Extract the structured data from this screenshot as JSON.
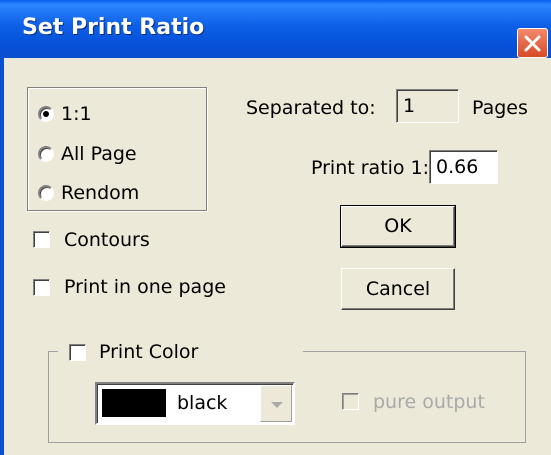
{
  "window": {
    "title": "Set Print Ratio",
    "close_icon": "close-icon"
  },
  "ratio_mode": {
    "options": [
      {
        "label": "1:1",
        "selected": true
      },
      {
        "label": "All Page",
        "selected": false
      },
      {
        "label": "Rendom",
        "selected": false
      }
    ]
  },
  "separated": {
    "label": "Separated to:",
    "value": "1",
    "unit": "Pages"
  },
  "print_ratio": {
    "label": "Print ratio 1:",
    "value": "0.66"
  },
  "buttons": {
    "ok": "OK",
    "cancel": "Cancel"
  },
  "checkboxes": {
    "contours": {
      "label": "Contours",
      "checked": false
    },
    "one_page": {
      "label": "Print in one page",
      "checked": false
    }
  },
  "print_color": {
    "label": "Print Color",
    "checked": false,
    "color_value": "black",
    "color_swatch": "#000000",
    "pure_output": {
      "label": "pure output",
      "checked": false,
      "disabled": true
    }
  }
}
